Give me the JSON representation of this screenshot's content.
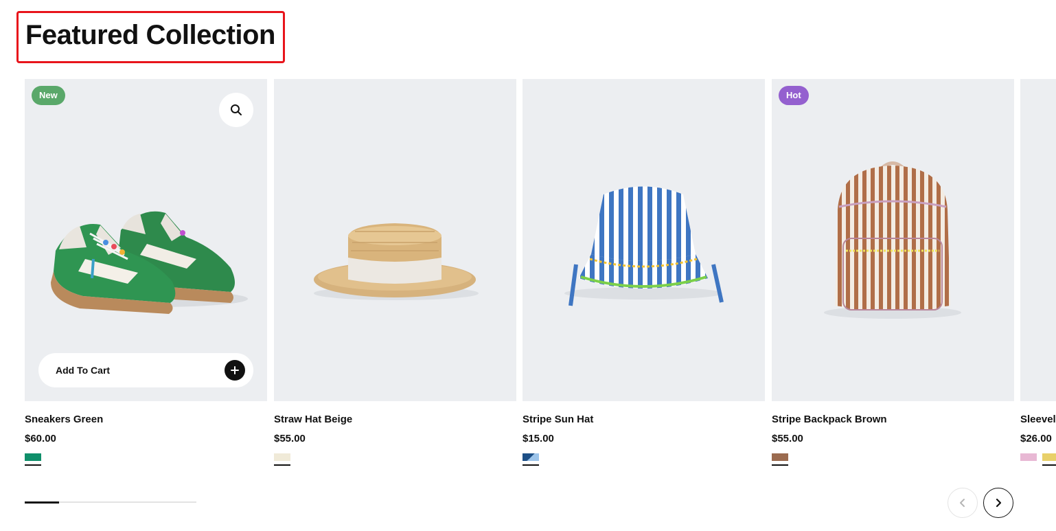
{
  "section": {
    "title": "Featured Collection"
  },
  "products": [
    {
      "name": "Sneakers Green",
      "price": "$60.00",
      "badge": "New",
      "badge_color": "#5aa86a",
      "swatches": [
        "#0f8f6a"
      ],
      "image_icon": "sneakers-image",
      "hovered": true,
      "add_to_cart_label": "Add To Cart"
    },
    {
      "name": "Straw Hat Beige",
      "price": "$55.00",
      "swatches": [
        "#f0ead8"
      ],
      "image_icon": "straw-hat-image"
    },
    {
      "name": "Stripe Sun Hat",
      "price": "$15.00",
      "swatches": [
        "split:#1d4f86:#9cc4ea"
      ],
      "image_icon": "bucket-hat-image"
    },
    {
      "name": "Stripe Backpack Brown",
      "price": "$55.00",
      "badge": "Hot",
      "badge_color": "#9460cf",
      "swatches": [
        "#9b6b4f"
      ],
      "image_icon": "backpack-image"
    },
    {
      "name": "Sleevel",
      "price": "$26.00",
      "swatches": [
        "#e8b8d4",
        "#e8d06a"
      ],
      "image_icon": "product-image",
      "partial": true
    }
  ],
  "carousel": {
    "progress_fraction": 0.2,
    "prev_icon": "chevron-left-icon",
    "next_icon": "chevron-right-icon",
    "prev_disabled": true
  },
  "colors": {
    "title_highlight_border": "#e8141b",
    "image_bg": "#eceef1",
    "text": "#111111"
  }
}
